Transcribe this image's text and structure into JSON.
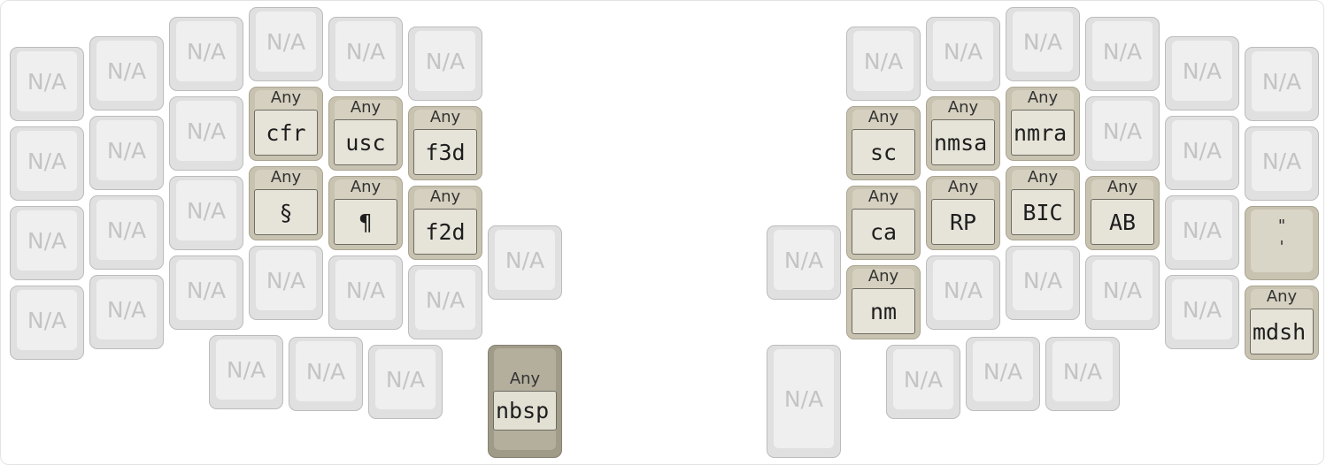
{
  "layout": {
    "na_label": "N/A",
    "any_label": "Any"
  },
  "keys": {
    "L_r2_c3": "cfr",
    "L_r2_c4": "usc",
    "L_r2_c5": "f3d",
    "L_r3_c3": "§",
    "L_r3_c4": "¶",
    "L_r3_c5": "f2d",
    "L_thumb": "nbsp",
    "R_r2_c0": "sc",
    "R_r2_c1": "nmsa",
    "R_r2_c2": "nmra",
    "R_r3_c0": "ca",
    "R_r3_c1": "RP",
    "R_r3_c2": "BIC",
    "R_r3_c3": "AB",
    "R_r4_c0": "nm",
    "R_quote_top": "\"",
    "R_quote_bottom": "'",
    "R_r4_c5": "mdsh"
  }
}
